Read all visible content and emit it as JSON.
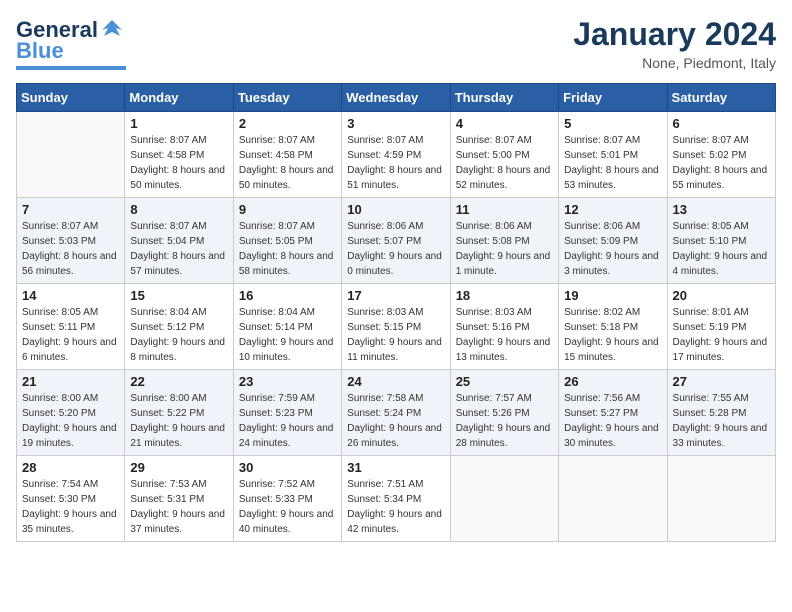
{
  "logo": {
    "line1": "General",
    "line2": "Blue"
  },
  "title": "January 2024",
  "subtitle": "None, Piedmont, Italy",
  "days_of_week": [
    "Sunday",
    "Monday",
    "Tuesday",
    "Wednesday",
    "Thursday",
    "Friday",
    "Saturday"
  ],
  "weeks": [
    [
      {
        "day": "",
        "sunrise": "",
        "sunset": "",
        "daylight": ""
      },
      {
        "day": "1",
        "sunrise": "Sunrise: 8:07 AM",
        "sunset": "Sunset: 4:58 PM",
        "daylight": "Daylight: 8 hours and 50 minutes."
      },
      {
        "day": "2",
        "sunrise": "Sunrise: 8:07 AM",
        "sunset": "Sunset: 4:58 PM",
        "daylight": "Daylight: 8 hours and 50 minutes."
      },
      {
        "day": "3",
        "sunrise": "Sunrise: 8:07 AM",
        "sunset": "Sunset: 4:59 PM",
        "daylight": "Daylight: 8 hours and 51 minutes."
      },
      {
        "day": "4",
        "sunrise": "Sunrise: 8:07 AM",
        "sunset": "Sunset: 5:00 PM",
        "daylight": "Daylight: 8 hours and 52 minutes."
      },
      {
        "day": "5",
        "sunrise": "Sunrise: 8:07 AM",
        "sunset": "Sunset: 5:01 PM",
        "daylight": "Daylight: 8 hours and 53 minutes."
      },
      {
        "day": "6",
        "sunrise": "Sunrise: 8:07 AM",
        "sunset": "Sunset: 5:02 PM",
        "daylight": "Daylight: 8 hours and 55 minutes."
      }
    ],
    [
      {
        "day": "7",
        "sunrise": "Sunrise: 8:07 AM",
        "sunset": "Sunset: 5:03 PM",
        "daylight": "Daylight: 8 hours and 56 minutes."
      },
      {
        "day": "8",
        "sunrise": "Sunrise: 8:07 AM",
        "sunset": "Sunset: 5:04 PM",
        "daylight": "Daylight: 8 hours and 57 minutes."
      },
      {
        "day": "9",
        "sunrise": "Sunrise: 8:07 AM",
        "sunset": "Sunset: 5:05 PM",
        "daylight": "Daylight: 8 hours and 58 minutes."
      },
      {
        "day": "10",
        "sunrise": "Sunrise: 8:06 AM",
        "sunset": "Sunset: 5:07 PM",
        "daylight": "Daylight: 9 hours and 0 minutes."
      },
      {
        "day": "11",
        "sunrise": "Sunrise: 8:06 AM",
        "sunset": "Sunset: 5:08 PM",
        "daylight": "Daylight: 9 hours and 1 minute."
      },
      {
        "day": "12",
        "sunrise": "Sunrise: 8:06 AM",
        "sunset": "Sunset: 5:09 PM",
        "daylight": "Daylight: 9 hours and 3 minutes."
      },
      {
        "day": "13",
        "sunrise": "Sunrise: 8:05 AM",
        "sunset": "Sunset: 5:10 PM",
        "daylight": "Daylight: 9 hours and 4 minutes."
      }
    ],
    [
      {
        "day": "14",
        "sunrise": "Sunrise: 8:05 AM",
        "sunset": "Sunset: 5:11 PM",
        "daylight": "Daylight: 9 hours and 6 minutes."
      },
      {
        "day": "15",
        "sunrise": "Sunrise: 8:04 AM",
        "sunset": "Sunset: 5:12 PM",
        "daylight": "Daylight: 9 hours and 8 minutes."
      },
      {
        "day": "16",
        "sunrise": "Sunrise: 8:04 AM",
        "sunset": "Sunset: 5:14 PM",
        "daylight": "Daylight: 9 hours and 10 minutes."
      },
      {
        "day": "17",
        "sunrise": "Sunrise: 8:03 AM",
        "sunset": "Sunset: 5:15 PM",
        "daylight": "Daylight: 9 hours and 11 minutes."
      },
      {
        "day": "18",
        "sunrise": "Sunrise: 8:03 AM",
        "sunset": "Sunset: 5:16 PM",
        "daylight": "Daylight: 9 hours and 13 minutes."
      },
      {
        "day": "19",
        "sunrise": "Sunrise: 8:02 AM",
        "sunset": "Sunset: 5:18 PM",
        "daylight": "Daylight: 9 hours and 15 minutes."
      },
      {
        "day": "20",
        "sunrise": "Sunrise: 8:01 AM",
        "sunset": "Sunset: 5:19 PM",
        "daylight": "Daylight: 9 hours and 17 minutes."
      }
    ],
    [
      {
        "day": "21",
        "sunrise": "Sunrise: 8:00 AM",
        "sunset": "Sunset: 5:20 PM",
        "daylight": "Daylight: 9 hours and 19 minutes."
      },
      {
        "day": "22",
        "sunrise": "Sunrise: 8:00 AM",
        "sunset": "Sunset: 5:22 PM",
        "daylight": "Daylight: 9 hours and 21 minutes."
      },
      {
        "day": "23",
        "sunrise": "Sunrise: 7:59 AM",
        "sunset": "Sunset: 5:23 PM",
        "daylight": "Daylight: 9 hours and 24 minutes."
      },
      {
        "day": "24",
        "sunrise": "Sunrise: 7:58 AM",
        "sunset": "Sunset: 5:24 PM",
        "daylight": "Daylight: 9 hours and 26 minutes."
      },
      {
        "day": "25",
        "sunrise": "Sunrise: 7:57 AM",
        "sunset": "Sunset: 5:26 PM",
        "daylight": "Daylight: 9 hours and 28 minutes."
      },
      {
        "day": "26",
        "sunrise": "Sunrise: 7:56 AM",
        "sunset": "Sunset: 5:27 PM",
        "daylight": "Daylight: 9 hours and 30 minutes."
      },
      {
        "day": "27",
        "sunrise": "Sunrise: 7:55 AM",
        "sunset": "Sunset: 5:28 PM",
        "daylight": "Daylight: 9 hours and 33 minutes."
      }
    ],
    [
      {
        "day": "28",
        "sunrise": "Sunrise: 7:54 AM",
        "sunset": "Sunset: 5:30 PM",
        "daylight": "Daylight: 9 hours and 35 minutes."
      },
      {
        "day": "29",
        "sunrise": "Sunrise: 7:53 AM",
        "sunset": "Sunset: 5:31 PM",
        "daylight": "Daylight: 9 hours and 37 minutes."
      },
      {
        "day": "30",
        "sunrise": "Sunrise: 7:52 AM",
        "sunset": "Sunset: 5:33 PM",
        "daylight": "Daylight: 9 hours and 40 minutes."
      },
      {
        "day": "31",
        "sunrise": "Sunrise: 7:51 AM",
        "sunset": "Sunset: 5:34 PM",
        "daylight": "Daylight: 9 hours and 42 minutes."
      },
      {
        "day": "",
        "sunrise": "",
        "sunset": "",
        "daylight": ""
      },
      {
        "day": "",
        "sunrise": "",
        "sunset": "",
        "daylight": ""
      },
      {
        "day": "",
        "sunrise": "",
        "sunset": "",
        "daylight": ""
      }
    ]
  ]
}
